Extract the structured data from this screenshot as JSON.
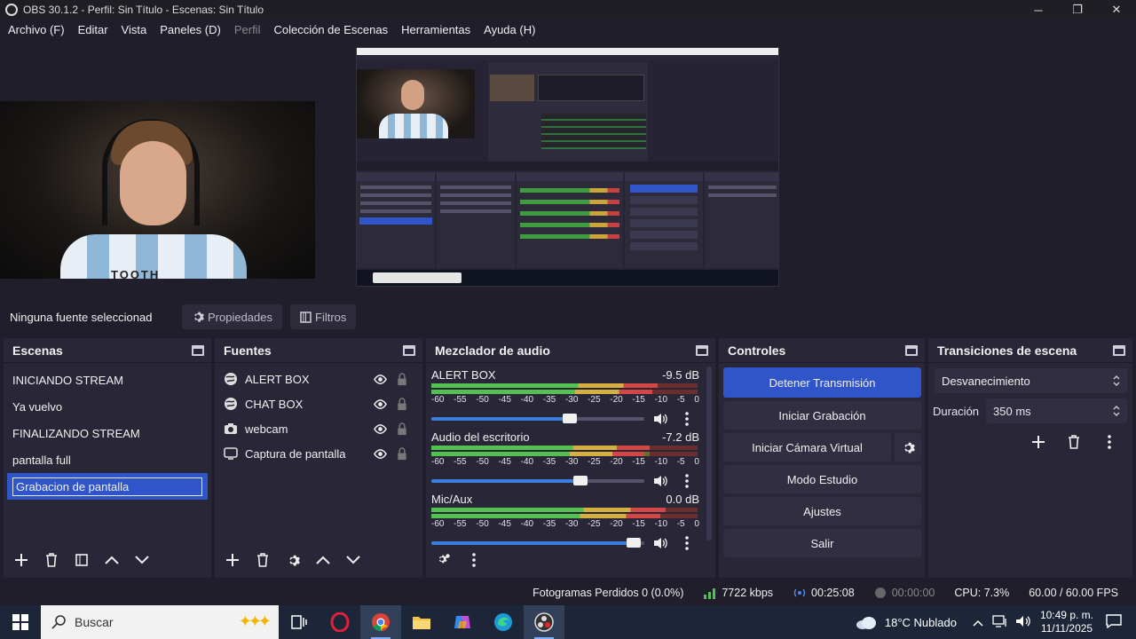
{
  "window": {
    "title": "OBS 30.1.2 - Perfil: Sin Título - Escenas: Sin Título",
    "minimize": "─",
    "restore": "❐",
    "close": "✕"
  },
  "menu": [
    "Archivo (F)",
    "Editar",
    "Vista",
    "Paneles (D)",
    "Perfil",
    "Colección de Escenas",
    "Herramientas",
    "Ayuda (H)"
  ],
  "webcam_shirt_text": "TOOTH",
  "source_toolbar": {
    "no_source": "Ninguna fuente seleccionad",
    "properties": "Propiedades",
    "filters": "Filtros"
  },
  "scenes": {
    "title": "Escenas",
    "items": [
      "INICIANDO STREAM",
      "Ya vuelvo",
      "FINALIZANDO STREAM",
      "pantalla full",
      "Grabacion de pantalla"
    ],
    "selected_index": 4
  },
  "sources": {
    "title": "Fuentes",
    "items": [
      {
        "label": "ALERT BOX",
        "icon": "browser-icon"
      },
      {
        "label": "CHAT BOX",
        "icon": "browser-icon"
      },
      {
        "label": "webcam",
        "icon": "camera-icon"
      },
      {
        "label": "Captura de pantalla",
        "icon": "monitor-icon"
      }
    ]
  },
  "mixer": {
    "title": "Mezclador de audio",
    "ticks": [
      "-60",
      "-55",
      "-50",
      "-45",
      "-40",
      "-35",
      "-30",
      "-25",
      "-20",
      "-15",
      "-10",
      "-5",
      "0"
    ],
    "channels": [
      {
        "name": "ALERT BOX",
        "db": "-9.5 dB",
        "volume": 0.65,
        "level": 0.85
      },
      {
        "name": "Audio del escritorio",
        "db": "-7.2 dB",
        "volume": 0.7,
        "level": 0.82
      },
      {
        "name": "Mic/Aux",
        "db": "0.0 dB",
        "volume": 0.95,
        "level": 0.88
      }
    ]
  },
  "controls": {
    "title": "Controles",
    "stop_stream": "Detener Transmisión",
    "start_recording": "Iniciar Grabación",
    "start_virtual_cam": "Iniciar Cámara Virtual",
    "studio_mode": "Modo Estudio",
    "settings": "Ajustes",
    "exit": "Salir"
  },
  "transitions": {
    "title": "Transiciones de escena",
    "selected": "Desvanecimiento",
    "duration_label": "Duración",
    "duration_value": "350 ms"
  },
  "status": {
    "dropped_frames": "Fotogramas Perdidos 0 (0.0%)",
    "bitrate": "7722 kbps",
    "stream_time": "00:25:08",
    "record_time": "00:00:00",
    "cpu": "CPU: 7.3%",
    "fps": "60.00 / 60.00 FPS"
  },
  "taskbar": {
    "search_placeholder": "Buscar",
    "weather": "18°C  Nublado",
    "time": "10:49 p. m.",
    "date": "11/11/2025"
  },
  "colors": {
    "accent": "#2f55c8",
    "panel": "#292737",
    "background": "#1f1e2a",
    "meter_green": "#52c152",
    "meter_yellow": "#d4b040",
    "meter_red": "#d24646"
  }
}
